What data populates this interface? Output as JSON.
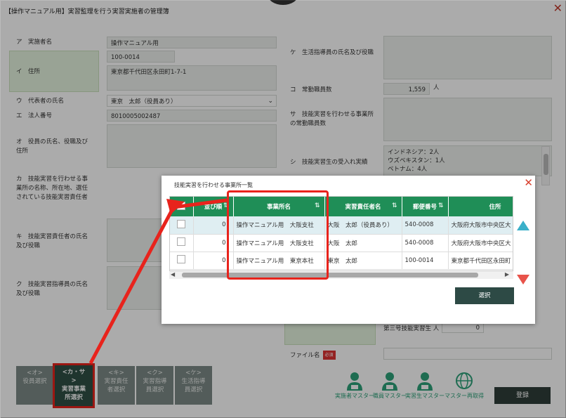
{
  "window": {
    "title": "【操作マニュアル用】実習監理を行う実習実施者の管理簿",
    "close": "✕"
  },
  "left": {
    "a_label": "ア　実施者名",
    "a_value": "操作マニュアル用",
    "i_label": "イ　住所",
    "i_zip": "100-0014",
    "i_address": "東京都千代田区永田町1-7-1",
    "u_label": "ウ　代表者の氏名",
    "u_value": "東京　太郎（役員あり）",
    "e_label": "エ　法人番号",
    "e_value": "8010005002487",
    "o_label": "オ　役員の氏名、役職及び住所",
    "ka_label": "カ　技能実習を行わせる事業所の名称、所在地、選任されている技能実習責任者",
    "ki_label": "キ　技能実習責任者の氏名及び役職",
    "ku_label": "ク　技能実習指導員の氏名及び役職"
  },
  "right": {
    "ke_label": "ケ　生活指導員の氏名及び役職",
    "ko_label": "コ　常勤職員数",
    "ko_value": "1,559",
    "ko_unit": "人",
    "sa_label": "サ　技能実習を行わせる事業所の常勤職員数",
    "shi_label": "シ　技能実習生の受入れ実績",
    "shi_lines": [
      "インドネシア：2人",
      "ウズベキスタン：1人",
      "ベトナム：4人"
    ],
    "third_label": "第三号技能実習生",
    "third_unit": "人",
    "third_value": "0",
    "file_label": "ファイル名",
    "file_req": "必須"
  },
  "modal": {
    "title": "技能実習を行わせる事業所一覧",
    "close": "✕",
    "columns": [
      "",
      "並び順",
      "事業所名",
      "実習責任者名",
      "郵便番号",
      "住所"
    ],
    "rows": [
      {
        "order": "0",
        "office": "操作マニュアル用　大阪支社",
        "manager": "大阪　太郎（役員あり）",
        "zip": "540-0008",
        "address": "大阪府大阪市中央区大"
      },
      {
        "order": "0",
        "office": "操作マニュアル用　大阪支社",
        "manager": "大阪　太郎",
        "zip": "540-0008",
        "address": "大阪府大阪市中央区大"
      },
      {
        "order": "0",
        "office": "操作マニュアル用　東京本社",
        "manager": "東京　太郎",
        "zip": "100-0014",
        "address": "東京都千代田区永田町"
      }
    ],
    "select_label": "選択"
  },
  "tabs": [
    {
      "lines": [
        "<オ>",
        "役員選択"
      ]
    },
    {
      "lines": [
        "<カ・サ",
        ">",
        "実習事業",
        "所選択"
      ]
    },
    {
      "lines": [
        "<キ>",
        "実習責任",
        "者選択"
      ]
    },
    {
      "lines": [
        "<ク>",
        "実習指導",
        "員選択"
      ]
    },
    {
      "lines": [
        "<ケ>",
        "生活指導",
        "員選択"
      ]
    }
  ],
  "masters": [
    "実施者マスター",
    "職員マスター",
    "実習生マスター",
    "マスター再取得"
  ],
  "register_label": "登録",
  "colors": {
    "green": "#1f8e57",
    "dark": "#2f5045",
    "red": "#e8231c",
    "teal": "#2ea17a"
  }
}
